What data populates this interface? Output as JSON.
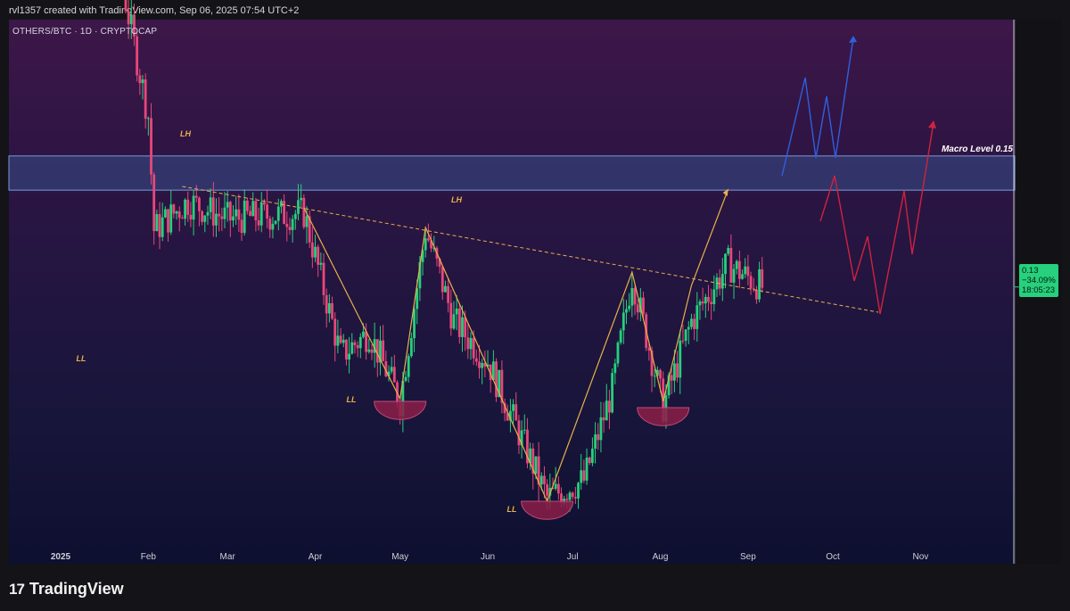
{
  "header": {
    "credit": "rvl1357 created with TradingView.com, Sep 06, 2025 07:54 UTC+2"
  },
  "symbol_line": "OTHERS/BTC · 1D · CRYPTOCAP",
  "price_label": {
    "value": "0.13",
    "change": "−34.09%",
    "countdown": "18:05:23"
  },
  "logo": {
    "mark": "17",
    "text": "TradingView"
  },
  "colors": {
    "up": "#26d07c",
    "down": "#e8477a",
    "zone": "#3a5a9a",
    "trend": "#e8b04a",
    "projection_blue": "#2f5fe0",
    "projection_red": "#d0223f",
    "bowl": "#8b1f49"
  },
  "annotations": {
    "macro_level": "Macro Level 0.15",
    "labels": [
      {
        "text": "LH",
        "color": "#e8b04a"
      },
      {
        "text": "LH",
        "color": "#e8b04a"
      },
      {
        "text": "LL",
        "color": "#e8b04a"
      },
      {
        "text": "LL",
        "color": "#e8b04a"
      },
      {
        "text": "LL",
        "color": "#e8b04a"
      }
    ]
  },
  "chart_data": {
    "type": "candlestick",
    "title": "OTHERS/BTC · 1D · CRYPTOCAP",
    "x_axis_ticks": [
      "2025",
      "Feb",
      "Mar",
      "Apr",
      "May",
      "Jun",
      "Jul",
      "Aug",
      "Sep",
      "Oct",
      "Nov"
    ],
    "y_axis_ticks": [],
    "last_value": 0.13,
    "last_change_pct": -34.09,
    "macro_level": 0.15,
    "close_path_approx": [
      {
        "x": "2025-01-01",
        "y": 0.2
      },
      {
        "x": "2025-01-20",
        "y": 0.19
      },
      {
        "x": "2025-02-01",
        "y": 0.16
      },
      {
        "x": "2025-02-03",
        "y": 0.14
      },
      {
        "x": "2025-02-15",
        "y": 0.145
      },
      {
        "x": "2025-03-01",
        "y": 0.142
      },
      {
        "x": "2025-03-28",
        "y": 0.143
      },
      {
        "x": "2025-04-10",
        "y": 0.118
      },
      {
        "x": "2025-04-20",
        "y": 0.122
      },
      {
        "x": "2025-05-01",
        "y": 0.11
      },
      {
        "x": "2025-05-10",
        "y": 0.14
      },
      {
        "x": "2025-05-20",
        "y": 0.124
      },
      {
        "x": "2025-06-01",
        "y": 0.117
      },
      {
        "x": "2025-06-22",
        "y": 0.093
      },
      {
        "x": "2025-07-05",
        "y": 0.096
      },
      {
        "x": "2025-07-15",
        "y": 0.112
      },
      {
        "x": "2025-07-22",
        "y": 0.132
      },
      {
        "x": "2025-08-02",
        "y": 0.109
      },
      {
        "x": "2025-08-12",
        "y": 0.124
      },
      {
        "x": "2025-08-25",
        "y": 0.134
      },
      {
        "x": "2025-09-06",
        "y": 0.13
      }
    ]
  }
}
